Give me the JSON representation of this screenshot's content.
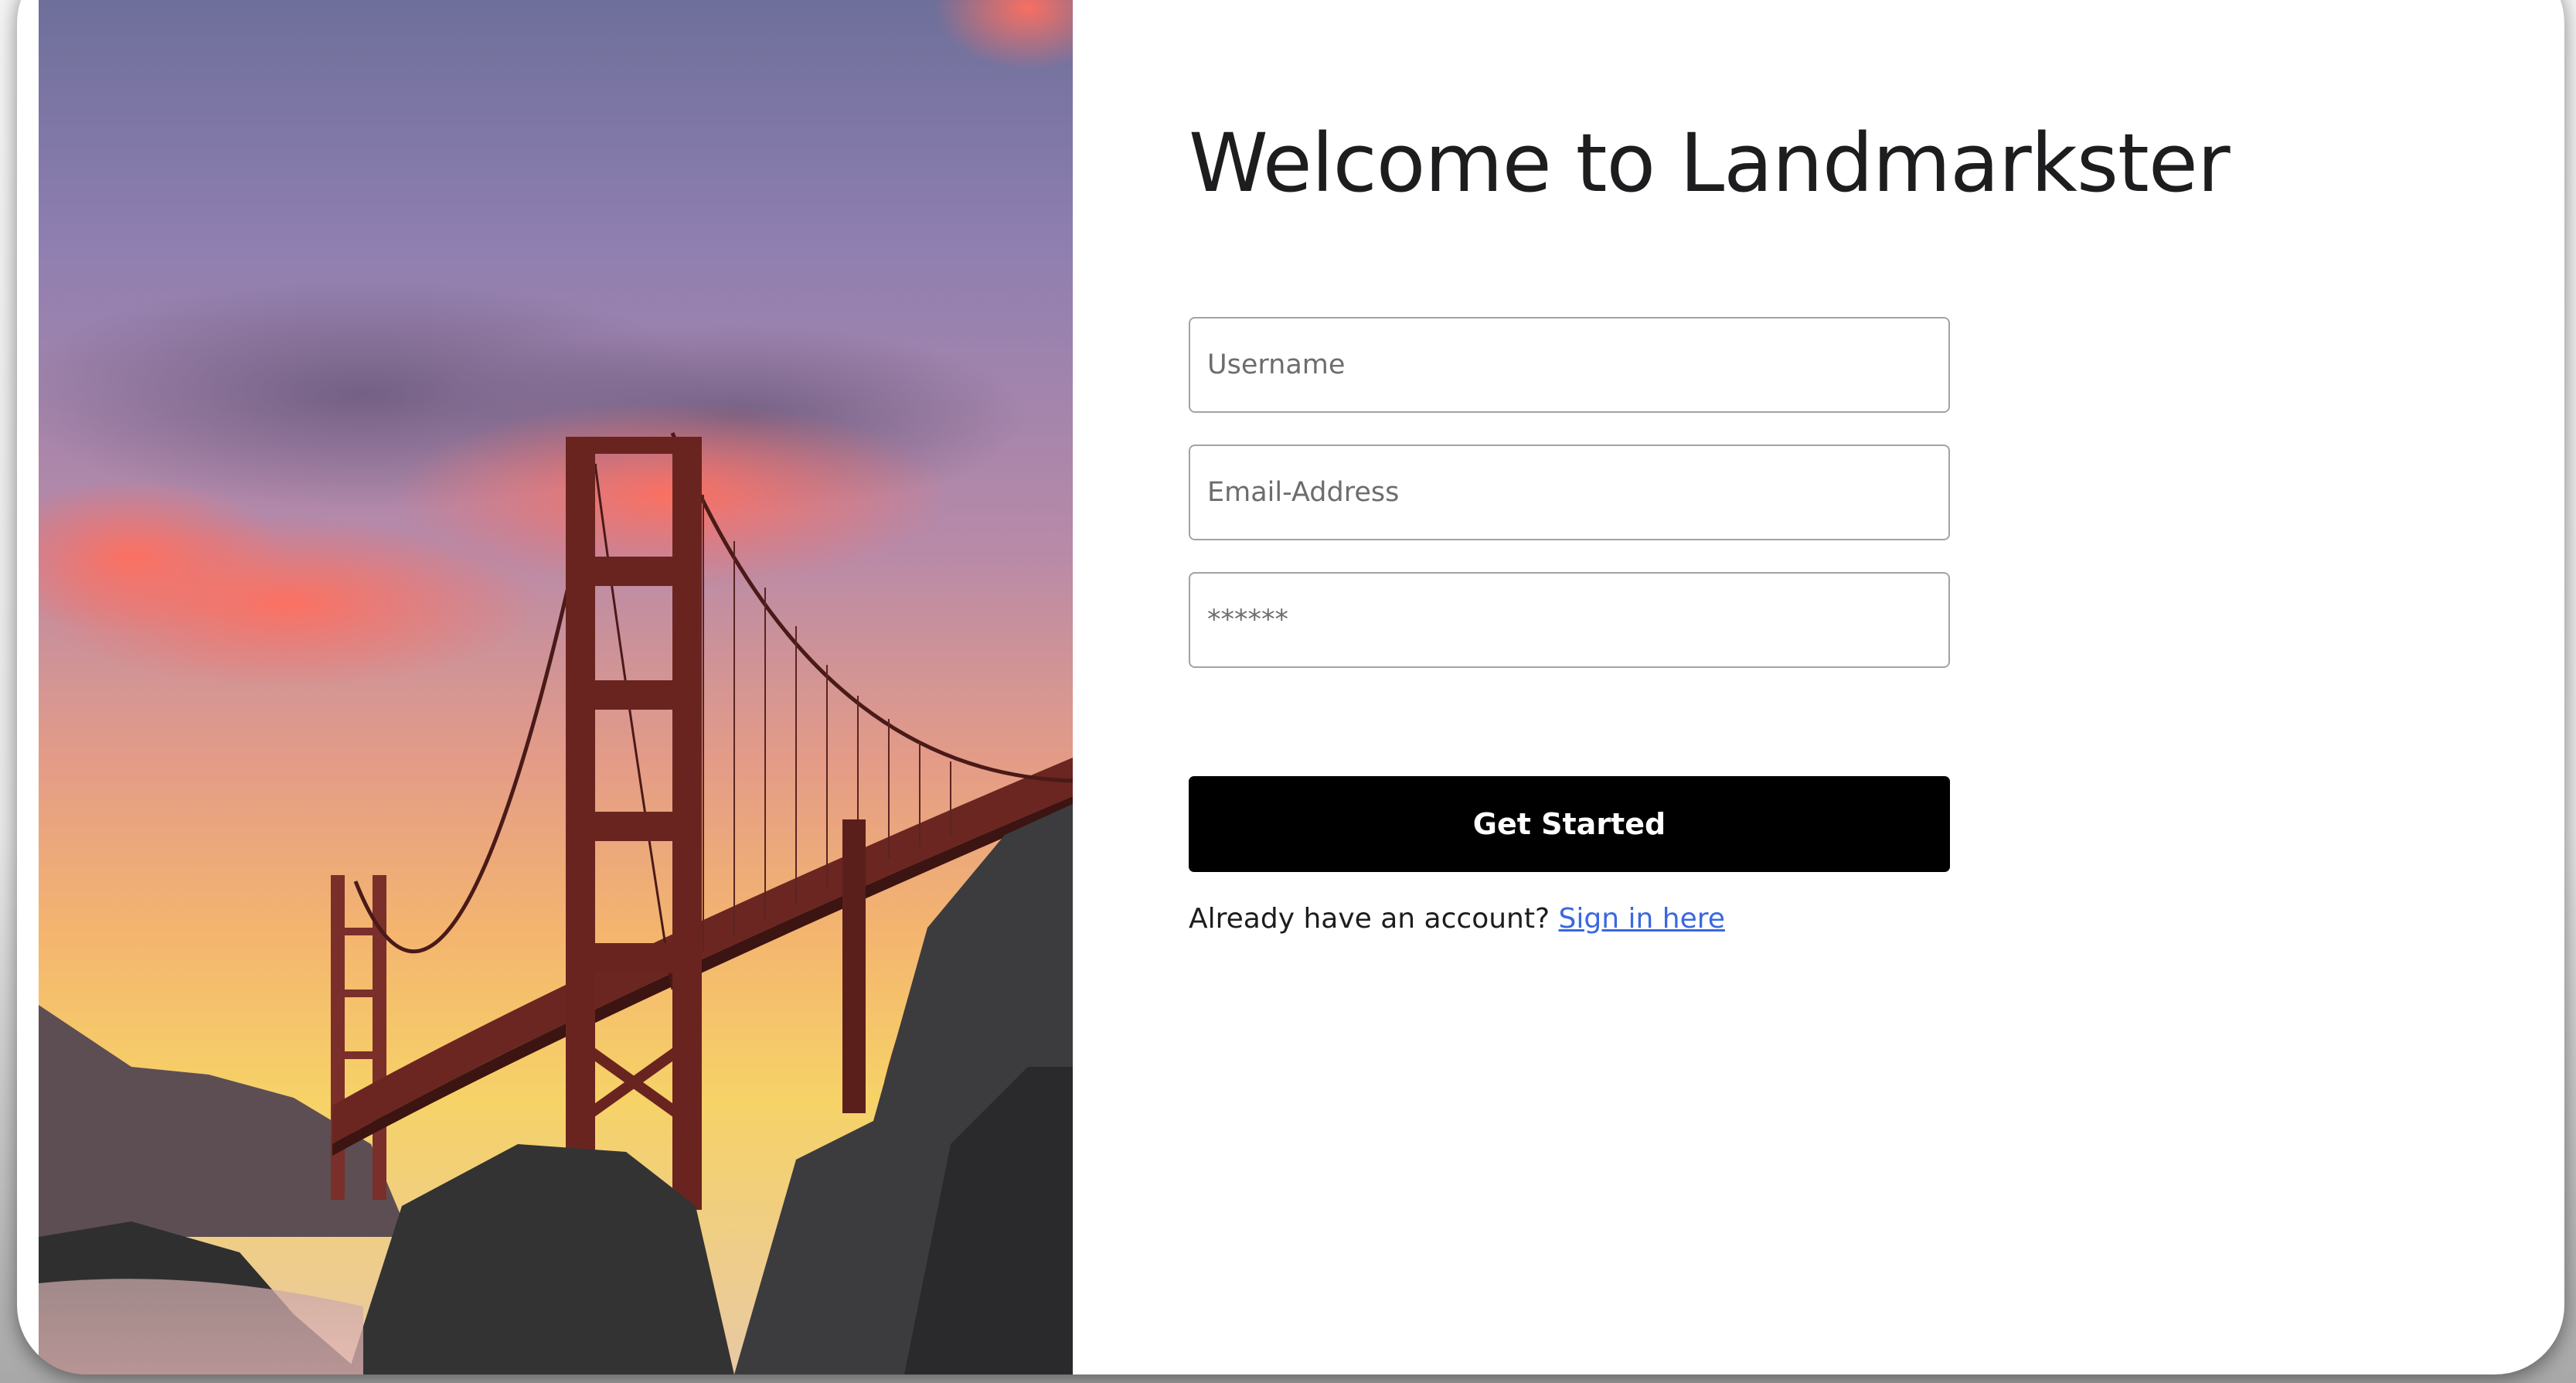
{
  "heading": {
    "title": "Welcome to Landmarkster"
  },
  "form": {
    "username_placeholder": "Username",
    "email_placeholder": "Email-Address",
    "password_placeholder": "******",
    "submit_label": "Get Started"
  },
  "footer": {
    "prompt": "Already have an account?",
    "link_label": "Sign in here"
  },
  "hero_image": {
    "subject": "golden-gate-bridge-sunset-photo"
  },
  "colors": {
    "button_bg": "#000000",
    "button_text": "#ffffff",
    "link": "#3a68e0",
    "field_border": "#a3a3a3"
  }
}
